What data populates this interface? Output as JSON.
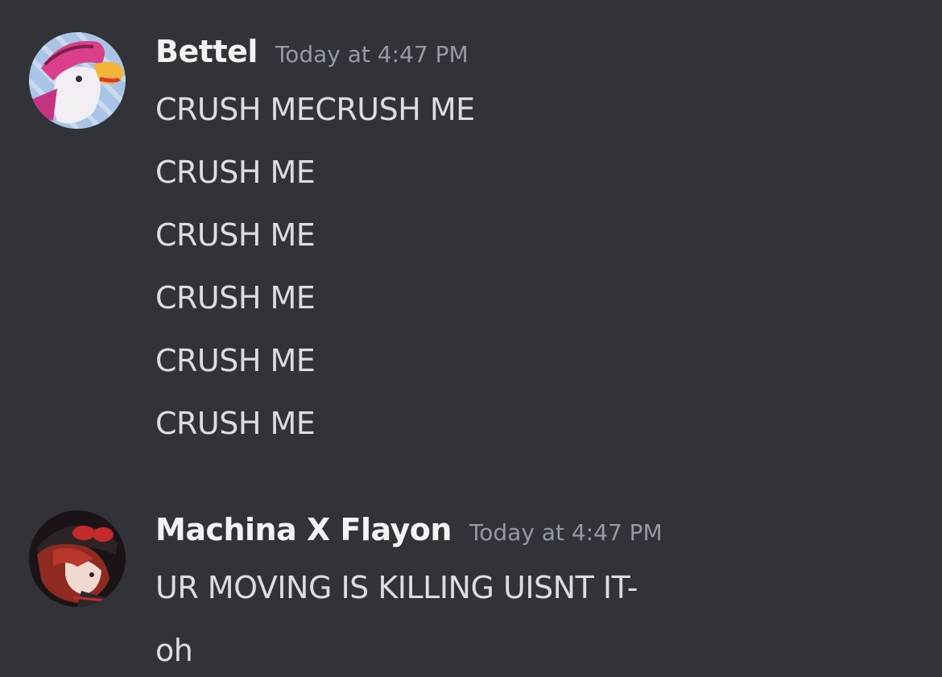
{
  "messages": [
    {
      "author": "Bettel",
      "timestamp": "Today at 4:47 PM",
      "avatar_icon": "goose-avatar-icon",
      "lines": [
        "CRUSH MECRUSH ME",
        "CRUSH ME",
        "CRUSH ME",
        "CRUSH ME",
        "CRUSH ME",
        "CRUSH ME"
      ]
    },
    {
      "author": "Machina X Flayon",
      "timestamp": "Today at 4:47 PM",
      "avatar_icon": "red-hair-character-avatar-icon",
      "lines": [
        "UR MOVING IS KILLING UISNT IT-",
        "oh"
      ]
    }
  ],
  "colors": {
    "background": "#313338",
    "author": "#f2f3f5",
    "timestamp": "#949ba4",
    "text": "#dbdee1"
  }
}
